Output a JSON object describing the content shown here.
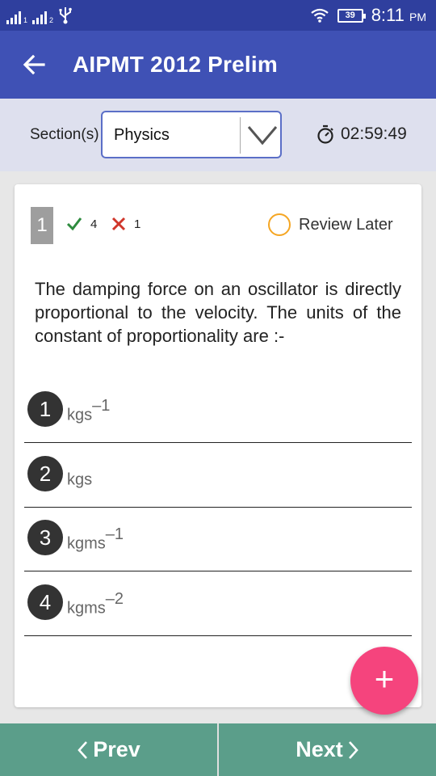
{
  "status_bar": {
    "sim1_label": "1",
    "sim2_label": "2",
    "battery": "39",
    "time": "8:11",
    "ampm": "PM"
  },
  "app_bar": {
    "title": "AIPMT 2012 Prelim"
  },
  "section_bar": {
    "label": "Section(s)",
    "selected_section": "Physics",
    "timer": "02:59:49"
  },
  "question": {
    "number": "1",
    "correct_marks": "4",
    "negative_marks": "1",
    "review_label": "Review Later",
    "text": "The damping force on an oscillator is directly proportional to the velocity. The units of the constant of proportionality are :-",
    "options": [
      {
        "num": "1",
        "text": "kgs",
        "sup": "–1"
      },
      {
        "num": "2",
        "text": "kgs",
        "sup": ""
      },
      {
        "num": "3",
        "text": "kgms",
        "sup": "–1"
      },
      {
        "num": "4",
        "text": "kgms",
        "sup": "–2"
      }
    ]
  },
  "fab": {
    "label": "+"
  },
  "nav": {
    "prev_label": "Prev",
    "next_label": "Next"
  },
  "colors": {
    "status_bar": "#2f3f9e",
    "app_bar": "#3f51b5",
    "section_bar": "#dee0ee",
    "fab": "#f5447d",
    "bottom_nav": "#5b9e8a",
    "correct": "#2e8b3e",
    "wrong": "#d0362b",
    "review_ring": "#f5a623"
  }
}
